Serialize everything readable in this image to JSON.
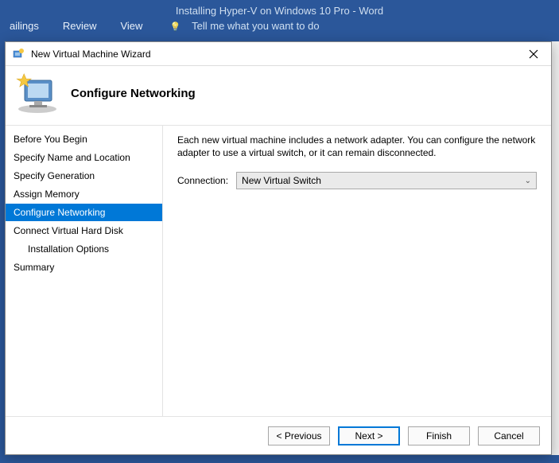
{
  "word": {
    "title": "Installing Hyper-V on Windows 10 Pro - Word",
    "ribbon": {
      "mailings": "ailings",
      "review": "Review",
      "view": "View",
      "tellme": "Tell me what you want to do"
    }
  },
  "dialog": {
    "title": "New Virtual Machine Wizard",
    "heading": "Configure Networking",
    "sidebar": [
      {
        "label": "Before You Begin",
        "selected": false,
        "indent": false
      },
      {
        "label": "Specify Name and Location",
        "selected": false,
        "indent": false
      },
      {
        "label": "Specify Generation",
        "selected": false,
        "indent": false
      },
      {
        "label": "Assign Memory",
        "selected": false,
        "indent": false
      },
      {
        "label": "Configure Networking",
        "selected": true,
        "indent": false
      },
      {
        "label": "Connect Virtual Hard Disk",
        "selected": false,
        "indent": false
      },
      {
        "label": "Installation Options",
        "selected": false,
        "indent": true
      },
      {
        "label": "Summary",
        "selected": false,
        "indent": false
      }
    ],
    "description": "Each new virtual machine includes a network adapter. You can configure the network adapter to use a virtual switch, or it can remain disconnected.",
    "connection_label": "Connection:",
    "connection_value": "New Virtual Switch",
    "buttons": {
      "previous": "< Previous",
      "next": "Next >",
      "finish": "Finish",
      "cancel": "Cancel"
    }
  }
}
